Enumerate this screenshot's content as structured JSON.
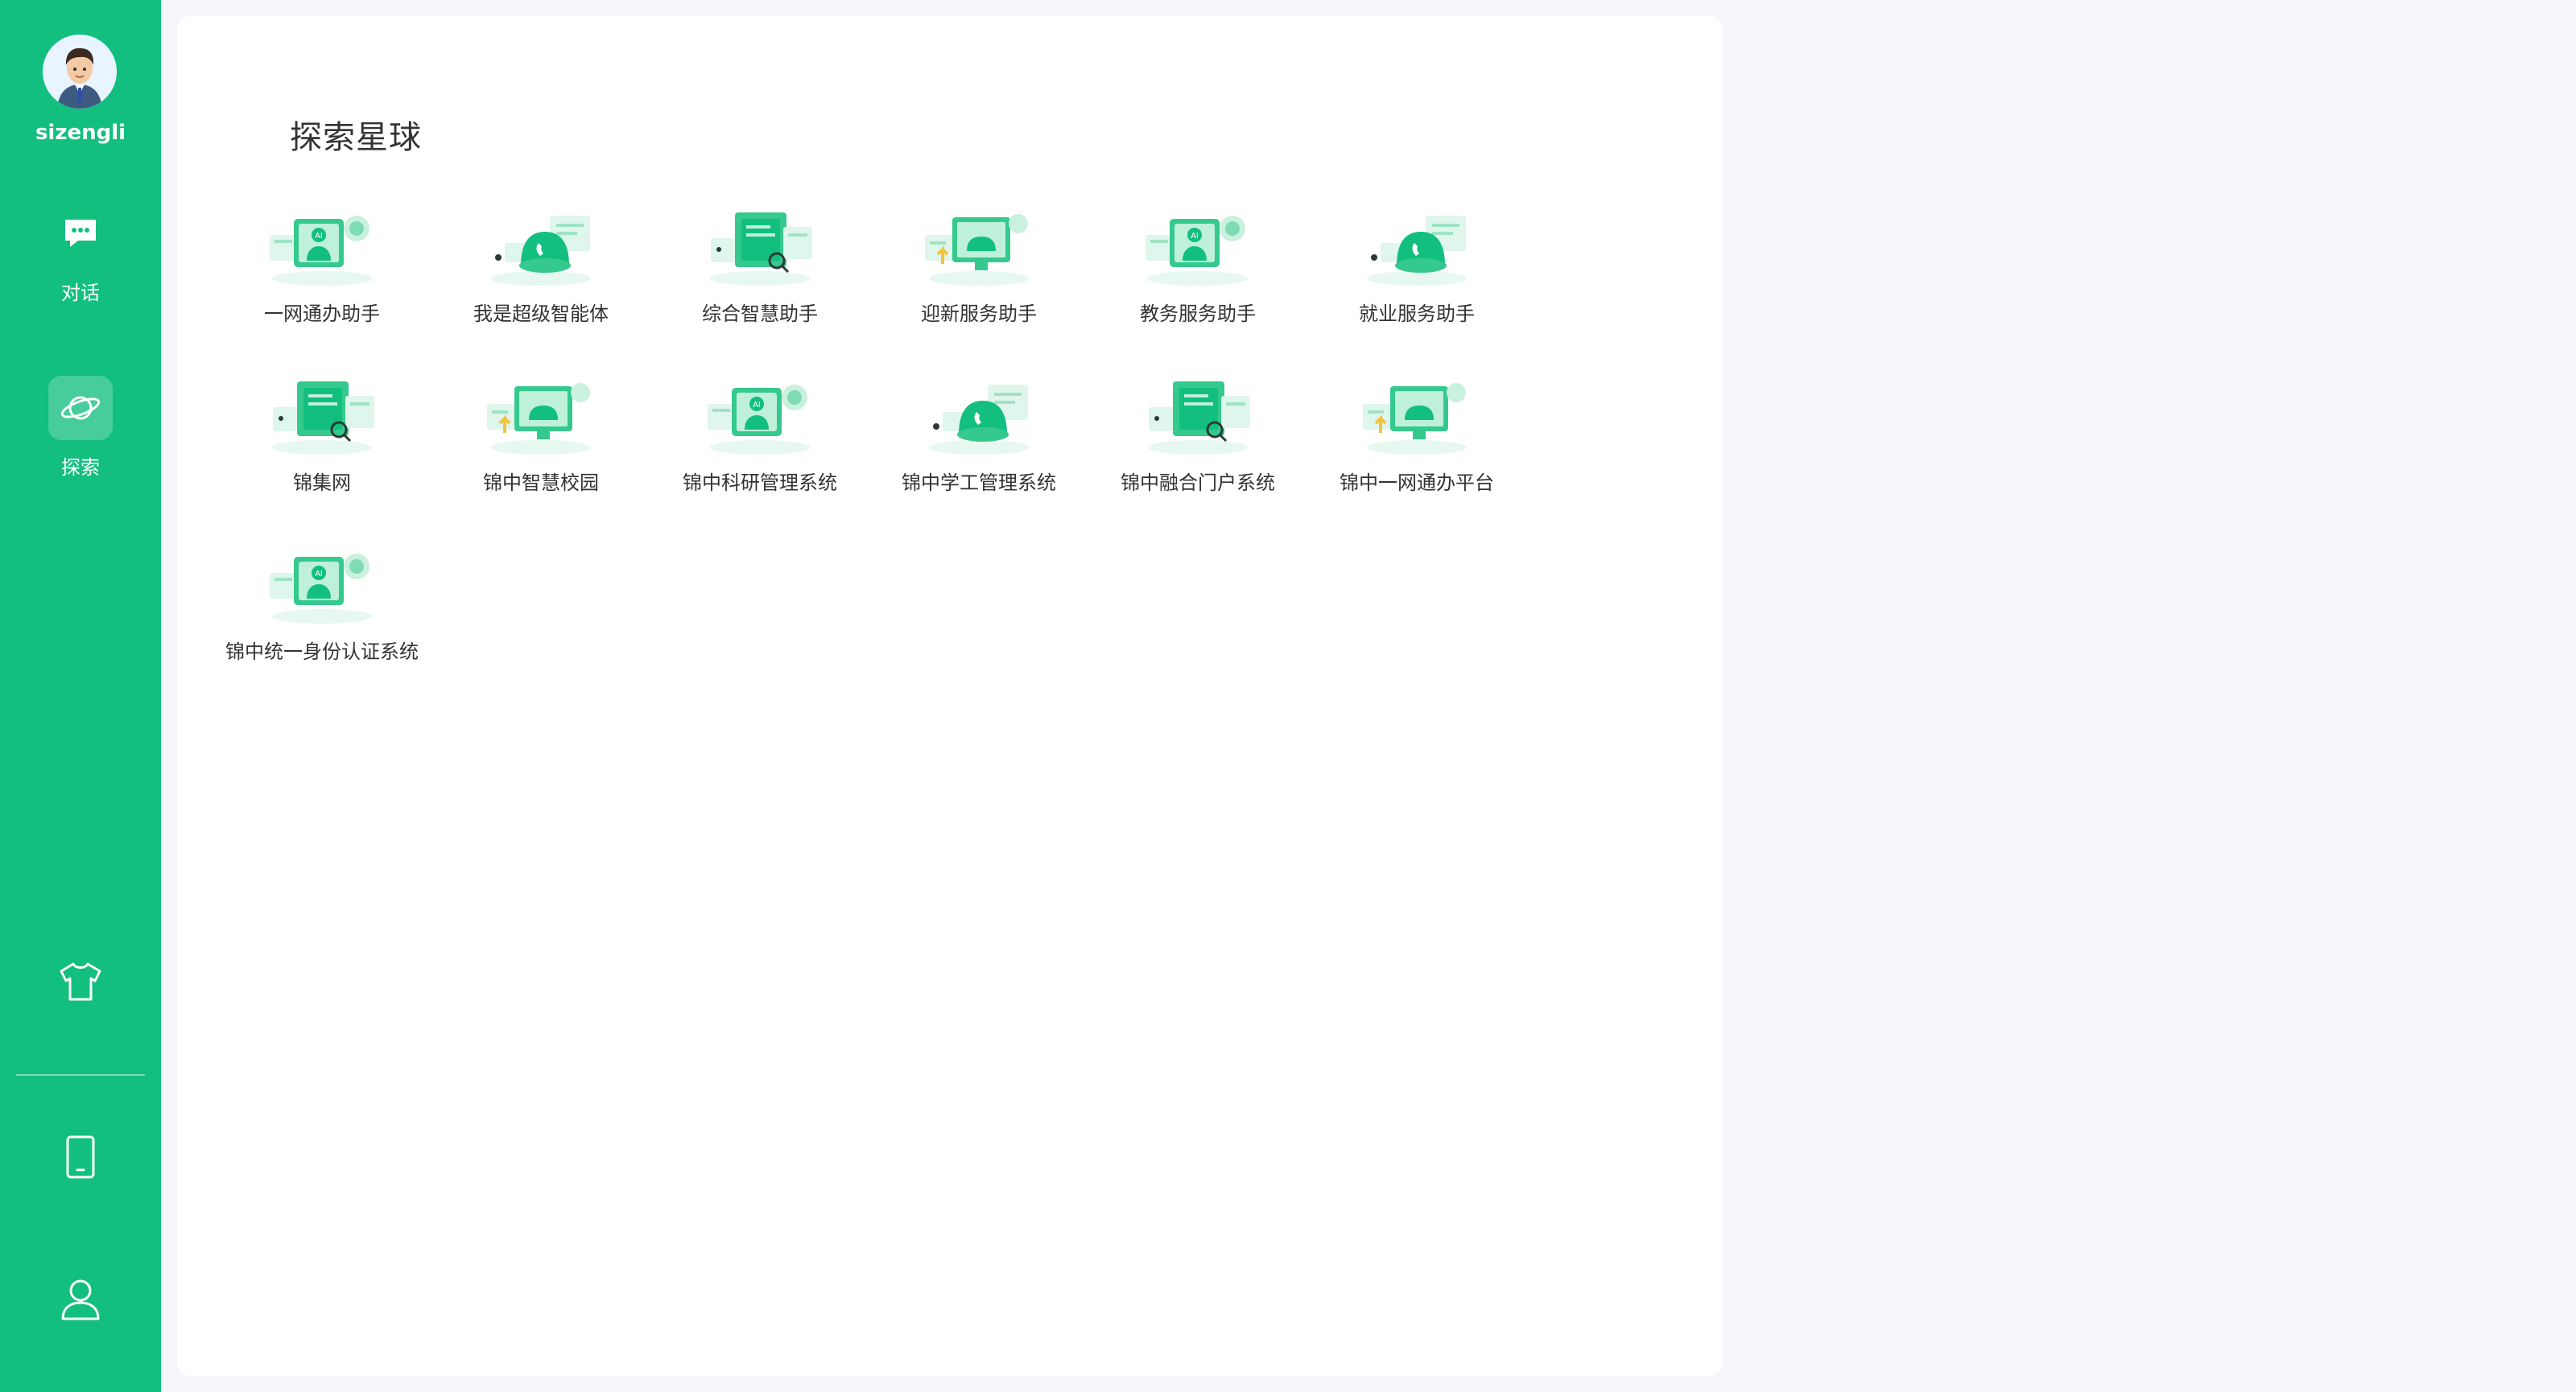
{
  "user": {
    "name": "sizengli"
  },
  "nav": [
    {
      "label": "对话",
      "icon": "chat-icon"
    },
    {
      "label": "探索",
      "icon": "planet-icon"
    }
  ],
  "page": {
    "title": "探索星球"
  },
  "apps": [
    {
      "label": "一网通办助手",
      "variant": "ai-person"
    },
    {
      "label": "我是超级智能体",
      "variant": "phone-call"
    },
    {
      "label": "综合智慧助手",
      "variant": "doc-search"
    },
    {
      "label": "迎新服务助手",
      "variant": "monitor-arrow"
    },
    {
      "label": "教务服务助手",
      "variant": "ai-person"
    },
    {
      "label": "就业服务助手",
      "variant": "phone-call"
    },
    {
      "label": "锦集网",
      "variant": "doc-search"
    },
    {
      "label": "锦中智慧校园",
      "variant": "monitor-arrow"
    },
    {
      "label": "锦中科研管理系统",
      "variant": "ai-person"
    },
    {
      "label": "锦中学工管理系统",
      "variant": "phone-call"
    },
    {
      "label": "锦中融合门户系统",
      "variant": "doc-search"
    },
    {
      "label": "锦中一网通办平台",
      "variant": "monitor-arrow"
    },
    {
      "label": "锦中统一身份认证系统",
      "variant": "ai-person"
    }
  ],
  "colors": {
    "brand": "#12bf7f",
    "card": "#ffffff",
    "background": "#f5f6fa"
  }
}
